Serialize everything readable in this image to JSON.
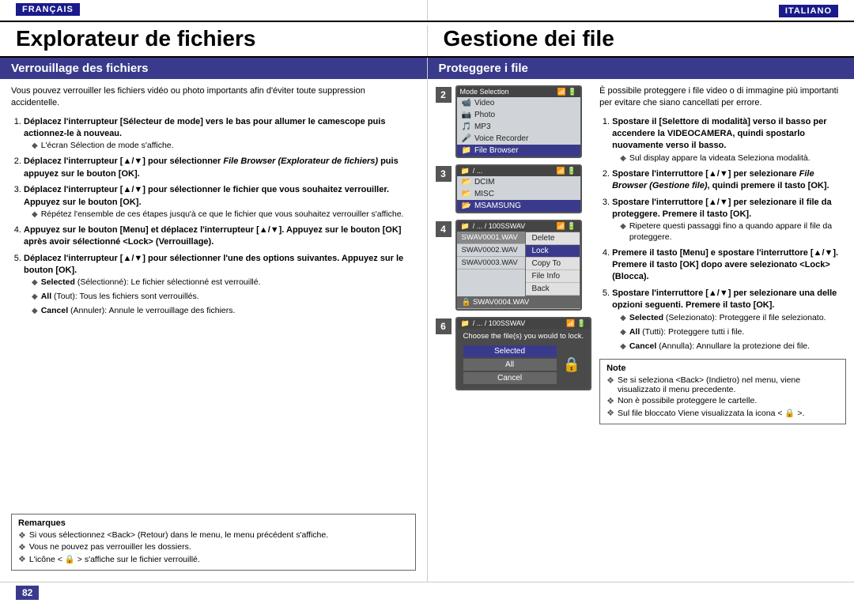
{
  "header": {
    "lang_left": "FRANÇAIS",
    "lang_right": "ITALIANO",
    "title_left": "Explorateur de fichiers",
    "title_right": "Gestione dei file"
  },
  "french": {
    "section_title": "Verrouillage des fichiers",
    "intro": "Vous pouvez verrouiller les fichiers vidéo ou photo importants afin d'éviter toute suppression accidentelle.",
    "steps": [
      {
        "num": 1,
        "text": "Déplacez l'interrupteur [Sélecteur de mode] vers le bas pour allumer le camescope puis actionnez-le à nouveau.",
        "bullets": [
          "L'écran Sélection de mode s'affiche."
        ]
      },
      {
        "num": 2,
        "text": "Déplacez l'interrupteur [▲/▼] pour sélectionner File Browser (Explorateur de fichiers) puis appuyez sur le bouton [OK].",
        "bullets": []
      },
      {
        "num": 3,
        "text": "Déplacez l'interrupteur [▲/▼] pour sélectionner le fichier que vous souhaitez verrouiller. Appuyez sur le bouton [OK].",
        "bullets": [
          "Répétez l'ensemble de ces étapes jusqu'à ce que le fichier que vous souhaitez verrouiller s'affiche."
        ]
      },
      {
        "num": 4,
        "text": "Appuyez sur le bouton [Menu] et déplacez l'interrupteur [▲/▼]. Appuyez sur le bouton [OK] après avoir sélectionné <Lock> (Verrouillage).",
        "bullets": []
      },
      {
        "num": 5,
        "text": "Déplacez l'interrupteur [▲/▼] pour sélectionner l'une des options suivantes. Appuyez sur le bouton [OK].",
        "bullets": [
          "Selected (Sélectionné): Le fichier sélectionné est verrouillé.",
          "All (Tout): Tous les fichiers sont verrouillés.",
          "Cancel (Annuler): Annule le verrouillage des fichiers."
        ]
      }
    ],
    "remarques_title": "Remarques",
    "remarques": [
      "Si vous sélectionnez <Back> (Retour) dans le menu, le menu précédent s'affiche.",
      "Vous ne pouvez pas verrouiller les dossiers.",
      "L'icône < 🔒 > s'affiche sur le fichier verrouillé."
    ]
  },
  "italian": {
    "section_title": "Proteggere i file",
    "intro": "È possibile proteggere i file video o di immagine più importanti per evitare che siano cancellati per errore.",
    "steps": [
      {
        "num": 1,
        "text": "Spostare il [Selettore di modalità] verso il basso per accendere la VIDEOCAMERA, quindi spostarlo nuovamente verso il basso.",
        "bullets": [
          "Sul display appare la videata Seleziona modalità."
        ]
      },
      {
        "num": 2,
        "text": "Spostare l'interruttore [▲/▼] per selezionare File Browser (Gestione file), quindi premere il tasto [OK].",
        "bullets": []
      },
      {
        "num": 3,
        "text": "Spostare l'interruttore [▲/▼] per selezionare il file da proteggere. Premere il tasto [OK].",
        "bullets": [
          "Ripetere questi passaggi fino a quando appare il file da proteggere."
        ]
      },
      {
        "num": 4,
        "text": "Premere il tasto [Menu] e spostare l'interruttore [▲/▼]. Premere il tasto [OK] dopo avere selezionato <Lock> (Blocca).",
        "bullets": []
      },
      {
        "num": 5,
        "text": "Spostare l'interruttore [▲/▼] per selezionare una delle opzioni seguenti. Premere il tasto [OK].",
        "bullets": [
          "Selected (Selezionato): Proteggere il file selezionato.",
          "All (Tutti): Proteggere tutti i file.",
          "Cancel (Annulla): Annullare la protezione dei file."
        ]
      }
    ],
    "note_title": "Note",
    "notes": [
      "Se si seleziona <Back> (Indietro) nel menu, viene visualizzato il menu precedente.",
      "Non è possibile proteggere le cartelle.",
      "Sul file bloccato Viene visualizzata la icona < 🔒 >."
    ]
  },
  "screens": {
    "step2_menu_title": "Mode Selection",
    "step2_items": [
      "Video",
      "Photo",
      "MP3",
      "Voice Recorder",
      "File Browser"
    ],
    "step3_path": "/ ...",
    "step3_folders": [
      "DCIM",
      "MISC",
      "MSAMSUNG"
    ],
    "step4_path": "/ ... / 100SSWAV",
    "step4_files": [
      "SWAV0001.WAV",
      "SWAV0002.WAV",
      "SWAV0003.WAV"
    ],
    "step4_menu": [
      "Delete",
      "Lock",
      "Copy To",
      "File Info",
      "Back"
    ],
    "step6_path": "/ ... / 100SSWAV",
    "step6_file": "SWAV0004.WAV",
    "step6_prompt": "Choose the file(s) you would to lock.",
    "step6_options": [
      "Selected",
      "All",
      "Cancel"
    ]
  },
  "footer": {
    "page_num": "82"
  }
}
